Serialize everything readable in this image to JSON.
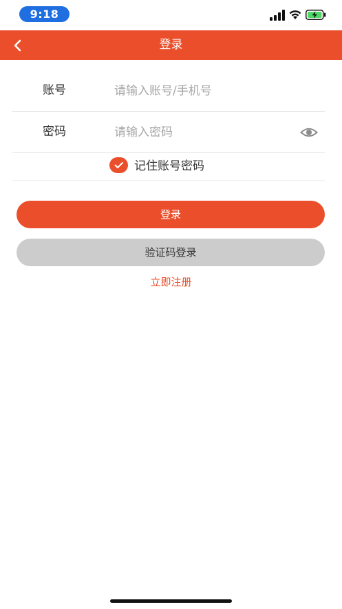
{
  "status_bar": {
    "time": "9:18",
    "icons": [
      "cellular-signal-icon",
      "wifi-icon",
      "battery-charging-icon"
    ]
  },
  "nav": {
    "title": "登录",
    "back_icon": "chevron-left-icon"
  },
  "form": {
    "account_label": "账号",
    "account_placeholder": "请输入账号/手机号",
    "password_label": "密码",
    "password_placeholder": "请输入密码",
    "eye_icon": "eye-icon",
    "remember_label": "记住账号密码",
    "remember_checked": true
  },
  "buttons": {
    "login_label": "登录",
    "code_login_label": "验证码登录",
    "register_label": "立即注册"
  },
  "colors": {
    "accent": "#ea4e2a",
    "secondary_button": "#cccccc",
    "time_pill": "#1f6fe0"
  }
}
